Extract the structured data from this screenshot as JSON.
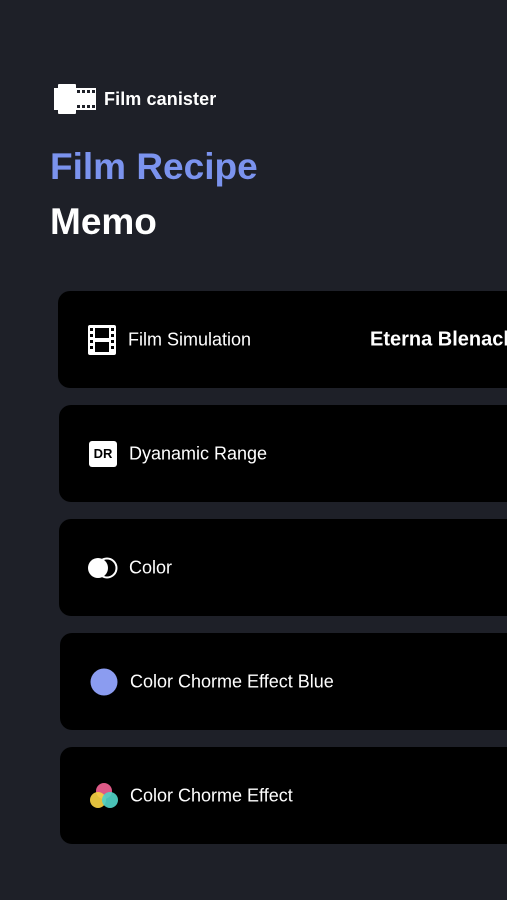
{
  "brand": {
    "icon": "film-canister-icon",
    "label": "Film canister"
  },
  "header": {
    "title_line1": "Film Recipe",
    "title_line2": "Memo"
  },
  "settings": [
    {
      "icon": "film-strip-icon",
      "label": "Film Simulation",
      "value": "Eterna Blenach"
    },
    {
      "icon": "dynamic-range-icon",
      "label": "Dyanamic Range",
      "icon_text": "DR"
    },
    {
      "icon": "color-circles-icon",
      "label": "Color"
    },
    {
      "icon": "blue-circle-icon",
      "label": "Color Chorme Effect Blue",
      "icon_color": "#8b9cf0"
    },
    {
      "icon": "tri-color-circles-icon",
      "label": "Color Chorme Effect",
      "icon_colors": [
        "#f06292",
        "#f5d042",
        "#4fd1c5"
      ]
    }
  ],
  "colors": {
    "background": "#1e2028",
    "card": "#000000",
    "accent": "#7b93ee",
    "text": "#ffffff"
  }
}
